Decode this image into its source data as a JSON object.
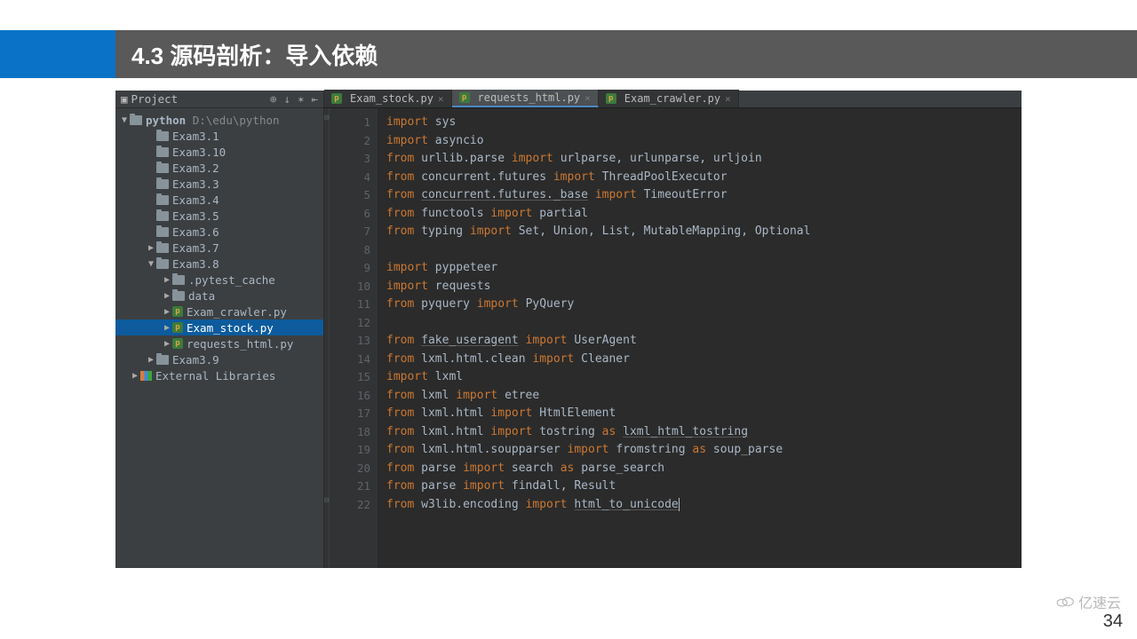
{
  "slide": {
    "title": "4.3 源码剖析：导入依赖",
    "page_num": "34",
    "logo": "亿速云"
  },
  "proj_panel": {
    "label": "Project",
    "icons": [
      "target",
      "sort",
      "gear",
      "collapse"
    ],
    "root": {
      "name": "python",
      "path": "D:\\edu\\python"
    },
    "items": [
      {
        "d": 1,
        "t": "fold",
        "name": "Exam3.1"
      },
      {
        "d": 1,
        "t": "fold",
        "name": "Exam3.10"
      },
      {
        "d": 1,
        "t": "fold",
        "name": "Exam3.2"
      },
      {
        "d": 1,
        "t": "fold",
        "name": "Exam3.3"
      },
      {
        "d": 1,
        "t": "fold",
        "name": "Exam3.4"
      },
      {
        "d": 1,
        "t": "fold",
        "name": "Exam3.5"
      },
      {
        "d": 1,
        "t": "fold",
        "name": "Exam3.6"
      },
      {
        "d": 1,
        "t": "fold",
        "name": "Exam3.7",
        "tw": "▶"
      },
      {
        "d": 1,
        "t": "fold",
        "name": "Exam3.8",
        "tw": "▼"
      },
      {
        "d": 2,
        "t": "fold",
        "name": ".pytest_cache",
        "tw": "▶"
      },
      {
        "d": 2,
        "t": "fold",
        "name": "data",
        "tw": "▶"
      },
      {
        "d": 2,
        "t": "py",
        "name": "Exam_crawler.py",
        "tw": "▶"
      },
      {
        "d": 2,
        "t": "py",
        "name": "Exam_stock.py",
        "tw": "▶",
        "sel": true
      },
      {
        "d": 2,
        "t": "py",
        "name": "requests_html.py",
        "tw": "▶"
      },
      {
        "d": 1,
        "t": "fold",
        "name": "Exam3.9",
        "tw": "▶"
      },
      {
        "d": 0,
        "t": "lib",
        "name": "External Libraries",
        "tw": "▶"
      }
    ]
  },
  "tabs": [
    {
      "name": "Exam_stock.py"
    },
    {
      "name": "requests_html.py",
      "active": true
    },
    {
      "name": "Exam_crawler.py"
    }
  ],
  "code": {
    "lines": [
      [
        [
          "kw",
          "import "
        ],
        [
          "id",
          "sys"
        ]
      ],
      [
        [
          "kw",
          "import "
        ],
        [
          "id",
          "asyncio"
        ]
      ],
      [
        [
          "kw",
          "from "
        ],
        [
          "id",
          "urllib.parse "
        ],
        [
          "kw",
          "import "
        ],
        [
          "id",
          "urlparse, urlunparse, urljoin"
        ]
      ],
      [
        [
          "kw",
          "from "
        ],
        [
          "id",
          "concurrent.futures "
        ],
        [
          "kw",
          "import "
        ],
        [
          "id",
          "ThreadPoolExecutor"
        ]
      ],
      [
        [
          "kw",
          "from "
        ],
        [
          "und",
          "concurrent.futures._base"
        ],
        [
          "id",
          " "
        ],
        [
          "kw",
          "import "
        ],
        [
          "id",
          "TimeoutError"
        ]
      ],
      [
        [
          "kw",
          "from "
        ],
        [
          "id",
          "functools "
        ],
        [
          "kw",
          "import "
        ],
        [
          "id",
          "partial"
        ]
      ],
      [
        [
          "kw",
          "from "
        ],
        [
          "id",
          "typing "
        ],
        [
          "kw",
          "import "
        ],
        [
          "id",
          "Set, Union, List, MutableMapping, Optional"
        ]
      ],
      [],
      [
        [
          "kw",
          "import "
        ],
        [
          "id",
          "pyppeteer"
        ]
      ],
      [
        [
          "kw",
          "import "
        ],
        [
          "id",
          "requests"
        ]
      ],
      [
        [
          "kw",
          "from "
        ],
        [
          "id",
          "pyquery "
        ],
        [
          "kw",
          "import "
        ],
        [
          "id",
          "PyQuery"
        ]
      ],
      [],
      [
        [
          "kw",
          "from "
        ],
        [
          "und",
          "fake_useragent"
        ],
        [
          "id",
          " "
        ],
        [
          "kw",
          "import "
        ],
        [
          "id",
          "UserAgent"
        ]
      ],
      [
        [
          "kw",
          "from "
        ],
        [
          "id",
          "lxml.html.clean "
        ],
        [
          "kw",
          "import "
        ],
        [
          "id",
          "Cleaner"
        ]
      ],
      [
        [
          "kw",
          "import "
        ],
        [
          "id",
          "lxml"
        ]
      ],
      [
        [
          "kw",
          "from "
        ],
        [
          "id",
          "lxml "
        ],
        [
          "kw",
          "import "
        ],
        [
          "id",
          "etree"
        ]
      ],
      [
        [
          "kw",
          "from "
        ],
        [
          "id",
          "lxml.html "
        ],
        [
          "kw",
          "import "
        ],
        [
          "id",
          "HtmlElement"
        ]
      ],
      [
        [
          "kw",
          "from "
        ],
        [
          "id",
          "lxml.html "
        ],
        [
          "kw",
          "import "
        ],
        [
          "id",
          "tostring "
        ],
        [
          "kw",
          "as "
        ],
        [
          "und",
          "lxml_html_tostring"
        ]
      ],
      [
        [
          "kw",
          "from "
        ],
        [
          "id",
          "lxml.html.soupparser "
        ],
        [
          "kw",
          "import "
        ],
        [
          "id",
          "fromstring "
        ],
        [
          "kw",
          "as "
        ],
        [
          "id",
          "soup_parse"
        ]
      ],
      [
        [
          "kw",
          "from "
        ],
        [
          "id",
          "parse "
        ],
        [
          "kw",
          "import "
        ],
        [
          "id",
          "search "
        ],
        [
          "kw",
          "as "
        ],
        [
          "id",
          "parse_search"
        ]
      ],
      [
        [
          "kw",
          "from "
        ],
        [
          "id",
          "parse "
        ],
        [
          "kw",
          "import "
        ],
        [
          "id",
          "findall, Result"
        ]
      ],
      [
        [
          "kw",
          "from "
        ],
        [
          "id",
          "w3lib.encoding "
        ],
        [
          "kw",
          "import "
        ],
        [
          "und",
          "html_to_unicode"
        ]
      ]
    ]
  }
}
